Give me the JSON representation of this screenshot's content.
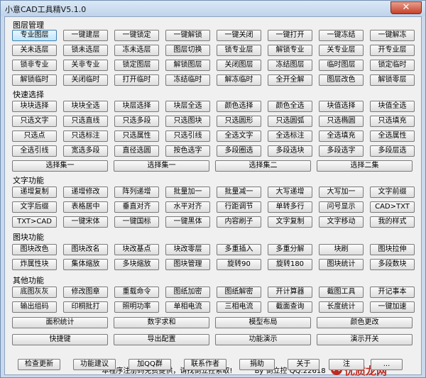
{
  "window": {
    "title": "小意CAD工具精V5.1.0",
    "close_symbol": "✕"
  },
  "sections": {
    "layers": "图层管理",
    "quick": "快速选择",
    "text": "文字功能",
    "block": "图块功能",
    "other": "其他功能"
  },
  "layers_rows": [
    [
      "专业图层",
      "一键建层",
      "一键锁定",
      "一键解锁",
      "一键关闭",
      "一键打开",
      "一键冻结",
      "一键解冻"
    ],
    [
      "关未选层",
      "锁未选层",
      "冻未选层",
      "图层切换",
      "锁专业层",
      "解锁专业",
      "关专业层",
      "开专业层"
    ],
    [
      "锁非专业",
      "关非专业",
      "锁定图层",
      "解锁图层",
      "关闭图层",
      "冻结图层",
      "临时图层",
      "锁定临时"
    ],
    [
      "解锁临时",
      "关闭临时",
      "打开临时",
      "冻结临时",
      "解冻临时",
      "全开全解",
      "图层改色",
      "解锁零层"
    ]
  ],
  "quick_rows": [
    [
      "块块选择",
      "块块全选",
      "块层选择",
      "块层全选",
      "颜色选择",
      "颜色全选",
      "块值选择",
      "块值全选"
    ],
    [
      "只选文字",
      "只选直线",
      "只选多段",
      "只选图块",
      "只选圆形",
      "只选圆弧",
      "只选椭圆",
      "只选填充"
    ],
    [
      "只选点",
      "只选标注",
      "只选属性",
      "只选引线",
      "全选文字",
      "全选标注",
      "全选填充",
      "全选属性"
    ],
    [
      "全选引线",
      "宽选多段",
      "直径选圆",
      "按色选字",
      "多段圈选",
      "多段选块",
      "多段选字",
      "多段层选"
    ]
  ],
  "quick_sets": [
    "选择集一",
    "选择集一",
    "选择集二",
    "选择二集"
  ],
  "text_rows": [
    [
      "递增复制",
      "递增修改",
      "阵列递增",
      "批量加一",
      "批量减一",
      "大写递增",
      "大写加一",
      "文字前缀"
    ],
    [
      "文字后缀",
      "表格居中",
      "垂直对齐",
      "水平对齐",
      "行距调节",
      "单转多行",
      "问号显示",
      "CAD>TXT"
    ],
    [
      "TXT>CAD",
      "一键宋体",
      "一键国标",
      "一键黑体",
      "内容刷子",
      "文字复制",
      "文字移动",
      "我的样式"
    ]
  ],
  "block_rows": [
    [
      "图块改色",
      "图块改名",
      "块改基点",
      "块改零层",
      "多重插入",
      "多重分解",
      "块刷",
      "图块拉伸"
    ],
    [
      "炸属性块",
      "集体缩放",
      "多块缩放",
      "图块管理",
      "旋转90",
      "旋转180",
      "图块统计",
      "多段数块"
    ]
  ],
  "other_rows": [
    [
      "底图灰灰",
      "修改图章",
      "重载命令",
      "图纸加密",
      "图纸解密",
      "开计算器",
      "截图工具",
      "开记事本"
    ],
    [
      "输出组码",
      "印桐批打",
      "照明功率",
      "单相电流",
      "三相电流",
      "截面查询",
      "长度统计",
      "一键加速"
    ]
  ],
  "other_wide": [
    "面积统计",
    "数字求和",
    "模型布局",
    "颜色更改"
  ],
  "big_buttons": [
    "快捷键",
    "导出配置",
    "功能演示",
    "演示开关"
  ],
  "footer": {
    "note": "本程序注册码免费提供，请找倒立控索取!",
    "author": "By 倒立控 QQ:22618",
    "watermark": "优质龙网"
  },
  "bottom_buttons": [
    "检查更新",
    "功能建议",
    "加QQ群",
    "联系作者",
    "捐助",
    "关于",
    "注",
    "..."
  ]
}
